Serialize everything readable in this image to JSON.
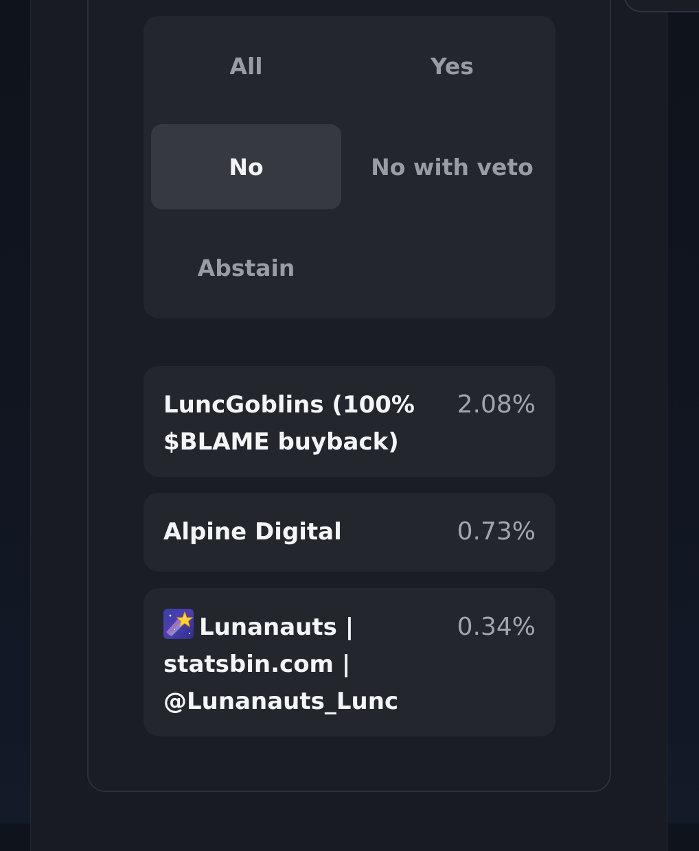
{
  "filters": {
    "options": [
      {
        "label": "All",
        "active": false
      },
      {
        "label": "Yes",
        "active": false
      },
      {
        "label": "No",
        "active": true
      },
      {
        "label": "No with veto",
        "active": false
      },
      {
        "label": "Abstain",
        "active": false
      }
    ]
  },
  "voters": [
    {
      "name": "LuncGoblins (100% $BLAME buyback)",
      "percent": "2.08%"
    },
    {
      "name": "Alpine Digital",
      "percent": "0.73%"
    },
    {
      "name": "Lunanauts | statsbin.com | @Lunanauts_Lunc",
      "percent": "0.34%",
      "icon": "shooting-star-icon"
    }
  ],
  "colors": {
    "background": "#181b21",
    "panel": "#23262d",
    "active_option": "#363940",
    "text_primary": "#f4f5f7",
    "text_muted": "#9a9ca3"
  }
}
